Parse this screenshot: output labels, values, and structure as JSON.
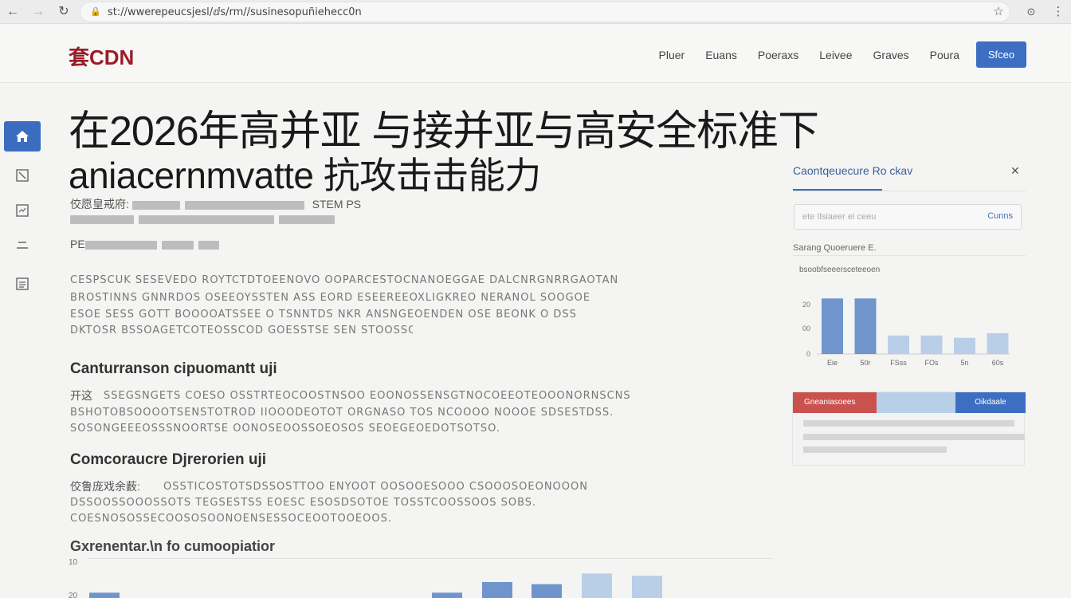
{
  "browser": {
    "back_icon": "arrow-left-icon",
    "url": "st://wwerepeucsjesl/ⅆs/rm//susinesopuñiehecc0n",
    "star_icon": "star-icon"
  },
  "header": {
    "logo": "套CDN",
    "nav": [
      "Pluer",
      "Euans",
      "Poeraxs",
      "Leivee",
      "Graves",
      "Poura"
    ],
    "cta_label": "Sfceo"
  },
  "rail": {
    "items": [
      {
        "icon": "home-icon",
        "glyph": "⌂",
        "active": true
      },
      {
        "icon": "edit-icon",
        "glyph": "◫",
        "active": false
      },
      {
        "icon": "chart-icon",
        "glyph": "⊡",
        "active": false
      },
      {
        "icon": "list-icon",
        "glyph": "☰",
        "active": false
      },
      {
        "icon": "document-icon",
        "glyph": "☷",
        "active": false
      }
    ]
  },
  "article": {
    "title_line1": "在2026年高并亚 与接并亚与高安全标准下",
    "title_line2": "aniacernmvatte 抗攻击击能力",
    "meta1_label": "佼愿皇戒府:",
    "meta1_tail": "STEM PS",
    "meta2_label": "PE",
    "para1": [
      "CESPSCUK SESEVEDO ROYTCTDTOEENOVO OOPARCESTOCNANOEGGAE DALCNRGNRRGAOTAN",
      "BROSTINNS GNNRDOS OSEEOYSSTEN  ASS EORD ESEEREEOXLIGKREO NERANOL SOOGOE",
      "ESOE SESS GOTT BOOOOATSSEE O  TSNNTDS NKR ANSNGEOENDEN OSE BEONK O DSS",
      "DKTOSR BSSOAGETCOTEOSSCOD GOESSTSE SEN STOOSSCOS."
    ],
    "section1_heading": "Canturranson cipuomantt uji",
    "section1_label": "开这",
    "para2": [
      "SSEGSNGETS COESO OSSTRTEOCOOSTNSOO EOONOSSENSGTNOCOEEOTEOOONORNSCNS",
      "BSHOTOBSOOOOTSENSTOTROD IIOOODEOTOT ORGNASO TOS NCOOOO  NOOOE  SDSESTDSS.",
      "SOSONGEEEOSSSNOORTSE OONOSEOOSSOEOSOS SEOEGEOEDOTSOTSO."
    ],
    "section2_heading": "Comcoraucre Djrerorien uji",
    "section2_label": "佼鲁庞戏余薮:",
    "para3": [
      "OSSTICOSTOTSDSSOSTTOO ENYOOT OOSOOESOOO CSOOOSOEONOOON",
      "DSSOOSSOOOSSOTS TEGSESTSS EOESC ESOSDSOTOE TOSSTCOOSSOOS SOBS.",
      "COESNOSOSSECOOSOSOONOENSESSOCEOOTOOEOOS."
    ],
    "bottom_heading": "Gxrenentar.\\n fo cumoopiatior",
    "bottom_axis": [
      "10",
      "20"
    ]
  },
  "sidebar": {
    "tab_label": "Caontqeuecure Ro ckav",
    "close_icon": "close-icon",
    "search_placeholder": "ete Ilsiaeer ei ceeu",
    "search_button": "Cunns",
    "label": "Sarang Quoeruere E.",
    "chart_title": "bsoobfseeersceteeoen",
    "card_red": "Gneaniasoees",
    "card_blue": "Oikdaale"
  },
  "chart_data": [
    {
      "type": "bar",
      "title": "bsoobfseeersceteeoen",
      "categories": [
        "Eie",
        "50r",
        "FSss",
        "FOs",
        "5n",
        "60s"
      ],
      "values": [
        24,
        24,
        8,
        8,
        7,
        9
      ],
      "yticks": [
        "",
        "20",
        "00",
        "0"
      ],
      "ylim": [
        0,
        30
      ],
      "colors": [
        "#6f95cc",
        "#6f95cc",
        "#b9cfe8",
        "#b9cfe8",
        "#b9cfe8",
        "#b9cfe8"
      ]
    },
    {
      "type": "bar",
      "title": "Gxrenentar.\\n fo cumoopiatior",
      "categories": [
        "",
        "",
        "",
        "",
        "",
        "",
        ""
      ],
      "values": [
        1,
        1,
        6,
        5,
        10,
        9,
        0
      ],
      "ylim": [
        0,
        12
      ],
      "colors": [
        "#6f95cc",
        "#6f95cc",
        "#6f95cc",
        "#6f95cc",
        "#b9cfe8",
        "#b9cfe8",
        "#b9cfe8"
      ]
    }
  ]
}
